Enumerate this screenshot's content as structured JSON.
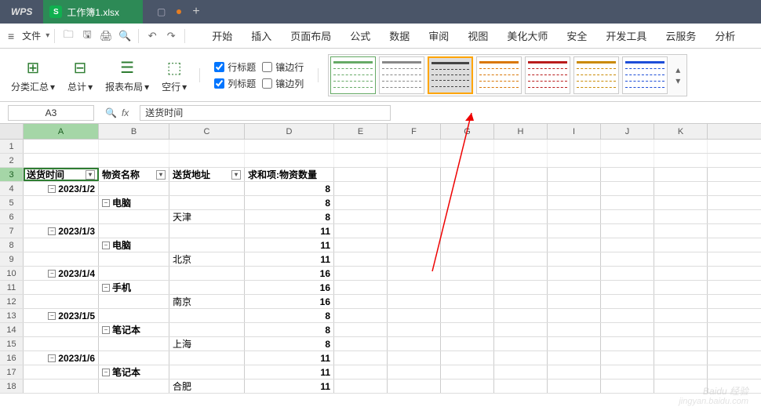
{
  "titlebar": {
    "app": "WPS",
    "doc": "工作簿1.xlsx"
  },
  "menubar": {
    "file": "文件",
    "tabs": [
      "开始",
      "插入",
      "页面布局",
      "公式",
      "数据",
      "审阅",
      "视图",
      "美化大师",
      "安全",
      "开发工具",
      "云服务",
      "分析"
    ]
  },
  "ribbon": {
    "group1": "分类汇总",
    "group2": "总计",
    "group3": "报表布局",
    "group4": "空行",
    "checks": {
      "rowh": "行标题",
      "colh": "列标题",
      "rowb": "镶边行",
      "colb": "镶边列"
    }
  },
  "formula_bar": {
    "namebox": "A3",
    "value": "送货时间"
  },
  "columns": [
    "A",
    "B",
    "C",
    "D",
    "E",
    "F",
    "G",
    "H",
    "I",
    "J",
    "K"
  ],
  "pivot": {
    "headers": [
      "送货时间",
      "物资名称",
      "送货地址",
      "求和项:物资数量"
    ],
    "rows": [
      {
        "r": 4,
        "a": "2023/1/2",
        "b": "",
        "c": "",
        "d": "8",
        "exp": "a"
      },
      {
        "r": 5,
        "a": "",
        "b": "电脑",
        "c": "",
        "d": "8",
        "exp": "b"
      },
      {
        "r": 6,
        "a": "",
        "b": "",
        "c": "天津",
        "d": "8"
      },
      {
        "r": 7,
        "a": "2023/1/3",
        "b": "",
        "c": "",
        "d": "11",
        "exp": "a"
      },
      {
        "r": 8,
        "a": "",
        "b": "电脑",
        "c": "",
        "d": "11",
        "exp": "b"
      },
      {
        "r": 9,
        "a": "",
        "b": "",
        "c": "北京",
        "d": "11"
      },
      {
        "r": 10,
        "a": "2023/1/4",
        "b": "",
        "c": "",
        "d": "16",
        "exp": "a"
      },
      {
        "r": 11,
        "a": "",
        "b": "手机",
        "c": "",
        "d": "16",
        "exp": "b"
      },
      {
        "r": 12,
        "a": "",
        "b": "",
        "c": "南京",
        "d": "16"
      },
      {
        "r": 13,
        "a": "2023/1/5",
        "b": "",
        "c": "",
        "d": "8",
        "exp": "a"
      },
      {
        "r": 14,
        "a": "",
        "b": "笔记本",
        "c": "",
        "d": "8",
        "exp": "b"
      },
      {
        "r": 15,
        "a": "",
        "b": "",
        "c": "上海",
        "d": "8"
      },
      {
        "r": 16,
        "a": "2023/1/6",
        "b": "",
        "c": "",
        "d": "11",
        "exp": "a"
      },
      {
        "r": 17,
        "a": "",
        "b": "笔记本",
        "c": "",
        "d": "11",
        "exp": "b"
      },
      {
        "r": 18,
        "a": "",
        "b": "",
        "c": "合肥",
        "d": "11"
      }
    ]
  },
  "watermark": {
    "main": "Baidu 经验",
    "sub": "jingyan.baidu.com"
  }
}
